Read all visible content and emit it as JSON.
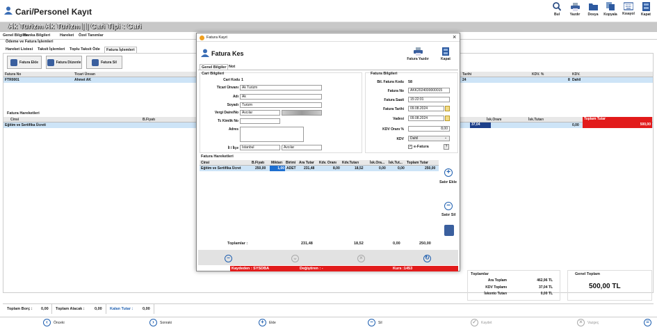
{
  "app": {
    "title": "Cari/Personel Kayıt"
  },
  "toolbar": [
    {
      "label": "Bul",
      "icon": "search-icon"
    },
    {
      "label": "Yazdır",
      "icon": "printer-icon"
    },
    {
      "label": "Dosya",
      "icon": "folder-icon"
    },
    {
      "label": "Kopyala",
      "icon": "copy-icon"
    },
    {
      "label": "Kısayol",
      "icon": "keyboard-icon"
    },
    {
      "label": "Kapat",
      "icon": "door-icon"
    }
  ],
  "header": {
    "text": "Ak Turizm Ak Turizm  | | Cari Tipi : Cari"
  },
  "main_tabs": [
    "Genel Bilgiler",
    "Banka Bilgileri",
    "Hareket",
    "Özel Tanımlar"
  ],
  "section_label": "Ödeme ve Fatura İşlemleri",
  "sub_tabs": [
    "Hareket Listesi",
    "Taksit İşlemleri",
    "Toplu Taksit Öde",
    "Fatura İşlemleri"
  ],
  "action_buttons": [
    "Fatura Ekle",
    "Fatura Düzenle",
    "Fatura Sil"
  ],
  "invoice_grid": {
    "headers": [
      "Fatura No",
      "Ticari Ünvan",
      "Tarihi",
      "KDV. %",
      "KDV."
    ],
    "row": {
      "no": "FTR0001",
      "unvan": "Ahmet AK",
      "tarih": "24",
      "kdv_pct": "8",
      "kdv": "Dahil"
    }
  },
  "movements": {
    "title": "Fatura Hareketleri",
    "headers": [
      "Cinsi",
      "B.Fiyatı",
      "İsk.Oranı",
      "İsk.Tutarı",
      "Toplam Tutar"
    ],
    "row": {
      "cinsi": "Eğitim ve Sertifika Ücreti",
      "kdv_tutar": "37,04",
      "isk_oran": "",
      "isk_tutar": "0,00",
      "toplam": "500,00"
    }
  },
  "totals": {
    "title": "Toplamlar",
    "ara_label": "Ara Toplam",
    "ara": "462,96 TL",
    "kdv_label": "KDV Toplamı",
    "kdv": "37,04 TL",
    "iskonto_label": "İskonto Tutarı",
    "iskonto": "0,00 TL"
  },
  "grand": {
    "title": "Genel Toplam",
    "value": "500,00 TL"
  },
  "status": {
    "borc_label": "Toplam Borç :",
    "borc": "0,00",
    "alacak_label": "Toplam Alacak :",
    "alacak": "0,00",
    "kalan_label": "Kalan Tutar :",
    "kalan": "0,00"
  },
  "nav": {
    "onceki": "Önceki",
    "sonraki": "Sonraki",
    "ekle": "Ekle",
    "sil": "Sil",
    "kaydet": "Kaydet",
    "vazgec": "Vazgeç"
  },
  "modal": {
    "window_title": "Fatura Kayıt",
    "heading": "Fatura Kes",
    "print_label": "Fatura Yazdır",
    "close_label": "Kapat",
    "tabs": [
      "Genel Bilgiler",
      "Not"
    ],
    "cari_title": "Cari Bilgileri",
    "cari": {
      "kodu_label": "Cari Kodu",
      "kodu": "1",
      "unvan_label": "Ticari Ünvanı",
      "unvan": "Ak Turizm",
      "adi_label": "Adı",
      "adi": "Ak",
      "soyadi_label": "Soyadı",
      "soyadi": "Turizm",
      "vd_label": "Vergi Daire/No",
      "vd": "Avcılar",
      "tc_label": "Tc Kimlik No",
      "adres_label": "Adres",
      "ililce_label": "İl / İlçe",
      "il": "İstanbul",
      "ilce": "Avcılar"
    },
    "fatura_title": "Fatura Bilgileri",
    "fatura": {
      "kodu_label": "Bil. Fatura Kodu",
      "kodu": "58",
      "no_label": "Fatura No",
      "no": "AKK2024000000015",
      "saat_label": "Fatura Saati",
      "saat": "15:22:01",
      "tarih_label": "Fatura Tarihi",
      "tarih": "09.08.2024",
      "vade_label": "Vadesi",
      "vade": "09.08.2024",
      "kdv_oran_label": "KDV Oranı %",
      "kdv_oran": "8,00",
      "kdv_label": "KDV",
      "kdv": "Dahil",
      "efatura": "e-Fatura"
    },
    "hareket_title": "Fatura Hareketleri",
    "hareket_headers": [
      "Cinsi",
      "B.Fiyatı",
      "Miktarı",
      "Birimi",
      "Ara Tutar",
      "Kdv. Oranı",
      "Kdv.Tutarı",
      "İsk.Ora...",
      "İsk.Tut...",
      "Toplam Tutar"
    ],
    "hareket_row": {
      "cinsi": "Eğitim ve Sertifika Ücret",
      "bfiyat": "250,00",
      "miktar": "1,00",
      "birim": "ADET",
      "ara": "231,48",
      "kdv_oran": "8,00",
      "kdv_tutar": "18,52",
      "isk_oran": "0,00",
      "isk_tutar": "0,00",
      "toplam": "250,00"
    },
    "toplamlar": {
      "label": "Toplamlar :",
      "ara": "231,48",
      "kdv": "18,52",
      "isk": "0,00",
      "toplam": "250,00"
    },
    "side_add": "Satır Ekle",
    "side_del": "Satır Sil",
    "status": {
      "kaydeden": "Kaydeden : SYSDBA",
      "degistiren": "Değiştiren : -",
      "kurs": "Kurs :1453"
    }
  }
}
